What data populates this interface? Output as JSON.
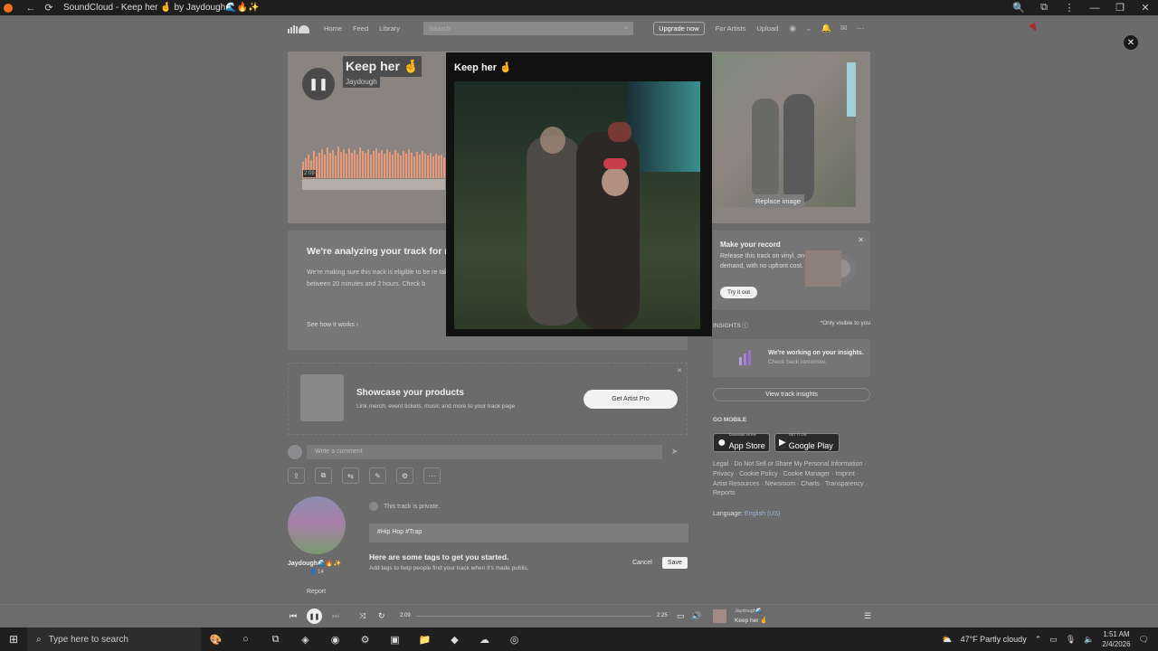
{
  "window": {
    "title": "SoundCloud - Keep her 🤞 by Jaydough🌊🔥✨",
    "controls": [
      "—",
      "❐",
      "✕"
    ]
  },
  "header": {
    "nav": [
      "Home",
      "Feed",
      "Library"
    ],
    "search_placeholder": "Search",
    "upgrade": "Upgrade now",
    "for_artists": "For Artists",
    "upload": "Upload"
  },
  "hero": {
    "title": "Keep her 🤞",
    "artist": "Jaydough",
    "time": "2:09",
    "replace_image": "Replace image"
  },
  "modal": {
    "title": "Keep her 🤞",
    "close": "✕"
  },
  "analyze": {
    "title": "We're analyzing your track for re",
    "text": "We're making sure this track is eligible to be re takes between 20 minutes and 2 hours. Check b",
    "link": "See how it works"
  },
  "make_record": {
    "title": "Make your record",
    "text": "Release this track on vinyl, on-demand, with no upfront cost.",
    "button": "Try it out",
    "close": "✕"
  },
  "insights": {
    "label": "INSIGHTS",
    "visibility": "*Only visible to you",
    "line1": "We're working on your insights.",
    "line2": "Check back tomorrow.",
    "view_button": "View track insights"
  },
  "mobile": {
    "label": "GO MOBILE",
    "app_store_small": "Download on the",
    "app_store": "App Store",
    "google_small": "GET IT ON",
    "google": "Google Play"
  },
  "footer": {
    "links": "Legal · Do Not Sell or Share My Personal Information · Privacy · Cookie Policy · Cookie Manager · Imprint · Artist Resources · Newsroom · Charts · Transparency Reports",
    "language_label": "Language:",
    "language": "English (US)"
  },
  "showcase": {
    "title": "Showcase your products",
    "text": "Link merch, event tickets, music and more to your track page",
    "button": "Get Artist Pro",
    "close": "✕"
  },
  "comment": {
    "placeholder": "Write a comment"
  },
  "artist": {
    "name": "Jaydough🌊🔥✨",
    "followers": "14",
    "report": "Report"
  },
  "track_meta": {
    "private": "This track is private.",
    "tags": "#Hip Hop  #Trap",
    "tags_heading": "Here are some tags to get you started.",
    "tags_text": "Add tags to help people find your track when it's made public.",
    "cancel": "Cancel",
    "save": "Save"
  },
  "player": {
    "current": "2:09",
    "duration": "2:25",
    "progress": 0,
    "now_artist": "Jaydough🌊",
    "now_title": "Keep her 🤞"
  },
  "taskbar": {
    "search": "Type here to search",
    "weather": "47°F  Partly cloudy",
    "time": "1:51 AM",
    "date": "2/4/2026"
  }
}
